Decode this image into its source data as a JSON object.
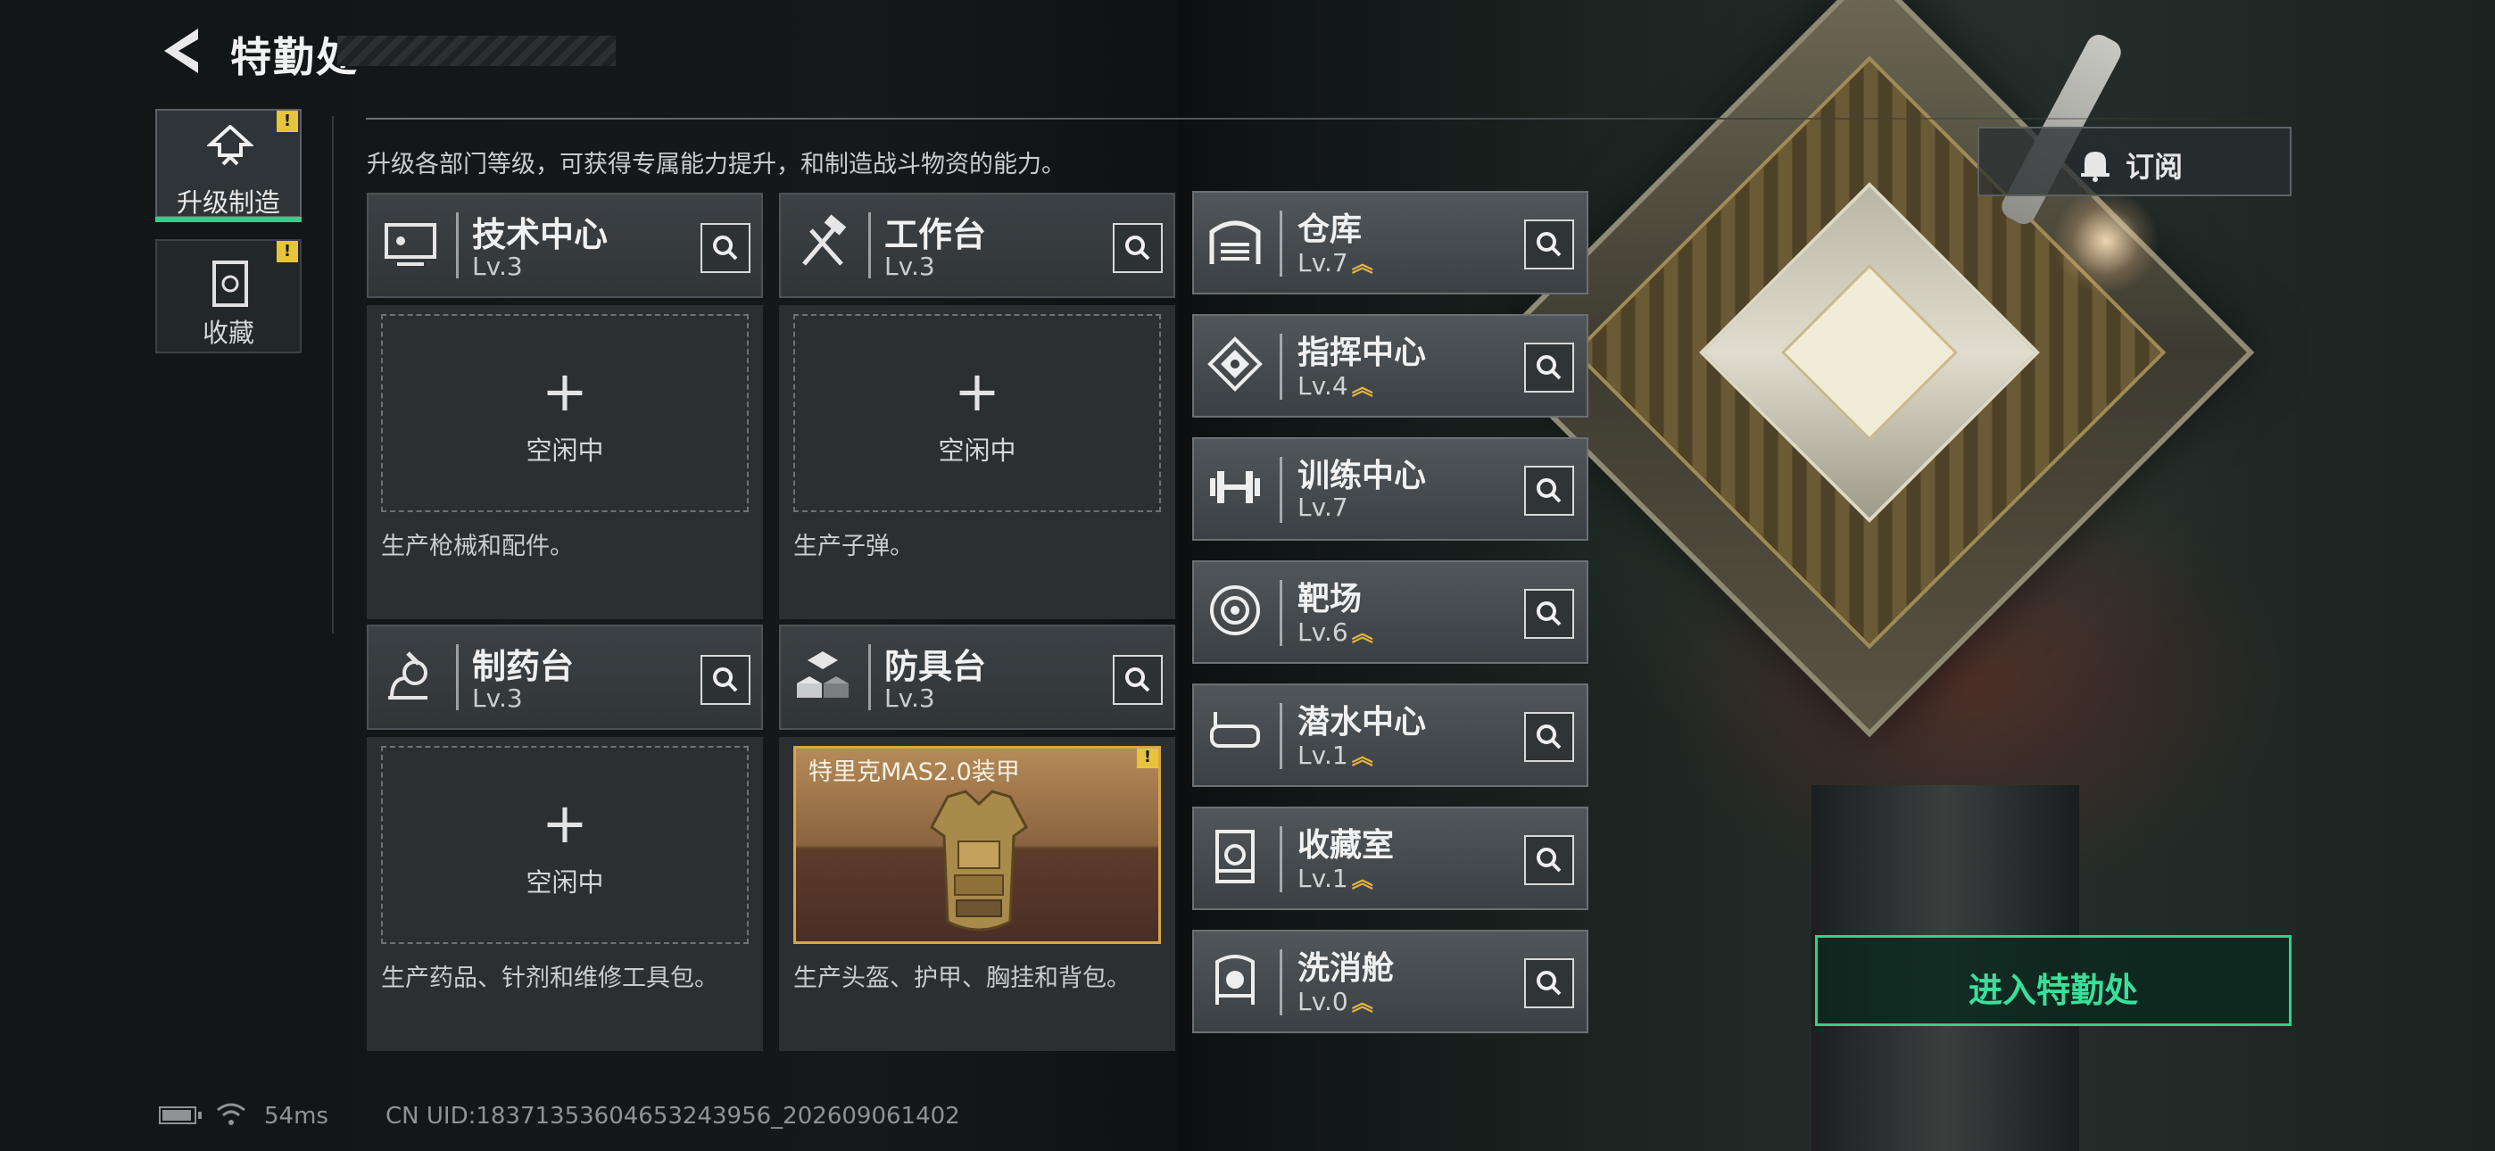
{
  "header": {
    "title": "特勤处",
    "subtitle": "升级各部门等级，可获得专属能力提升，和制造战斗物资的能力。"
  },
  "side_tabs": [
    {
      "label": "升级制造",
      "active": true,
      "badge": "!"
    },
    {
      "label": "收藏",
      "active": false,
      "badge": "!"
    }
  ],
  "workshops": [
    {
      "name": "技术中心",
      "level": "Lv.3",
      "slot_plus": "+",
      "slot_status": "空闲中",
      "desc": "生产枪械和配件。"
    },
    {
      "name": "工作台",
      "level": "Lv.3",
      "slot_plus": "+",
      "slot_status": "空闲中",
      "desc": "生产子弹。"
    },
    {
      "name": "制药台",
      "level": "Lv.3",
      "slot_plus": "+",
      "slot_status": "空闲中",
      "desc": "生产药品、针剂和维修工具包。"
    },
    {
      "name": "防具台",
      "level": "Lv.3",
      "item_name": "特里克MAS2.0装甲",
      "item_badge": "!",
      "desc": "生产头盔、护甲、胸挂和背包。"
    }
  ],
  "facilities": [
    {
      "name": "仓库",
      "level": "Lv.7",
      "upgradable": true
    },
    {
      "name": "指挥中心",
      "level": "Lv.4",
      "upgradable": true
    },
    {
      "name": "训练中心",
      "level": "Lv.7",
      "upgradable": false
    },
    {
      "name": "靶场",
      "level": "Lv.6",
      "upgradable": true
    },
    {
      "name": "潜水中心",
      "level": "Lv.1",
      "upgradable": true
    },
    {
      "name": "收藏室",
      "level": "Lv.1",
      "upgradable": true
    },
    {
      "name": "洗消舱",
      "level": "Lv.0",
      "upgradable": true
    }
  ],
  "upgrade_glyph": "︽",
  "buttons": {
    "subscribe": "订阅",
    "enter": "进入特勤处"
  },
  "status_bar": {
    "ping": "54ms",
    "uid": "CN UID:18371353604653243956_202609061402"
  },
  "colors": {
    "accent_green": "#2fd28a",
    "upgrade_gold": "#e3b43f",
    "badge_yellow": "#e7c43a"
  }
}
